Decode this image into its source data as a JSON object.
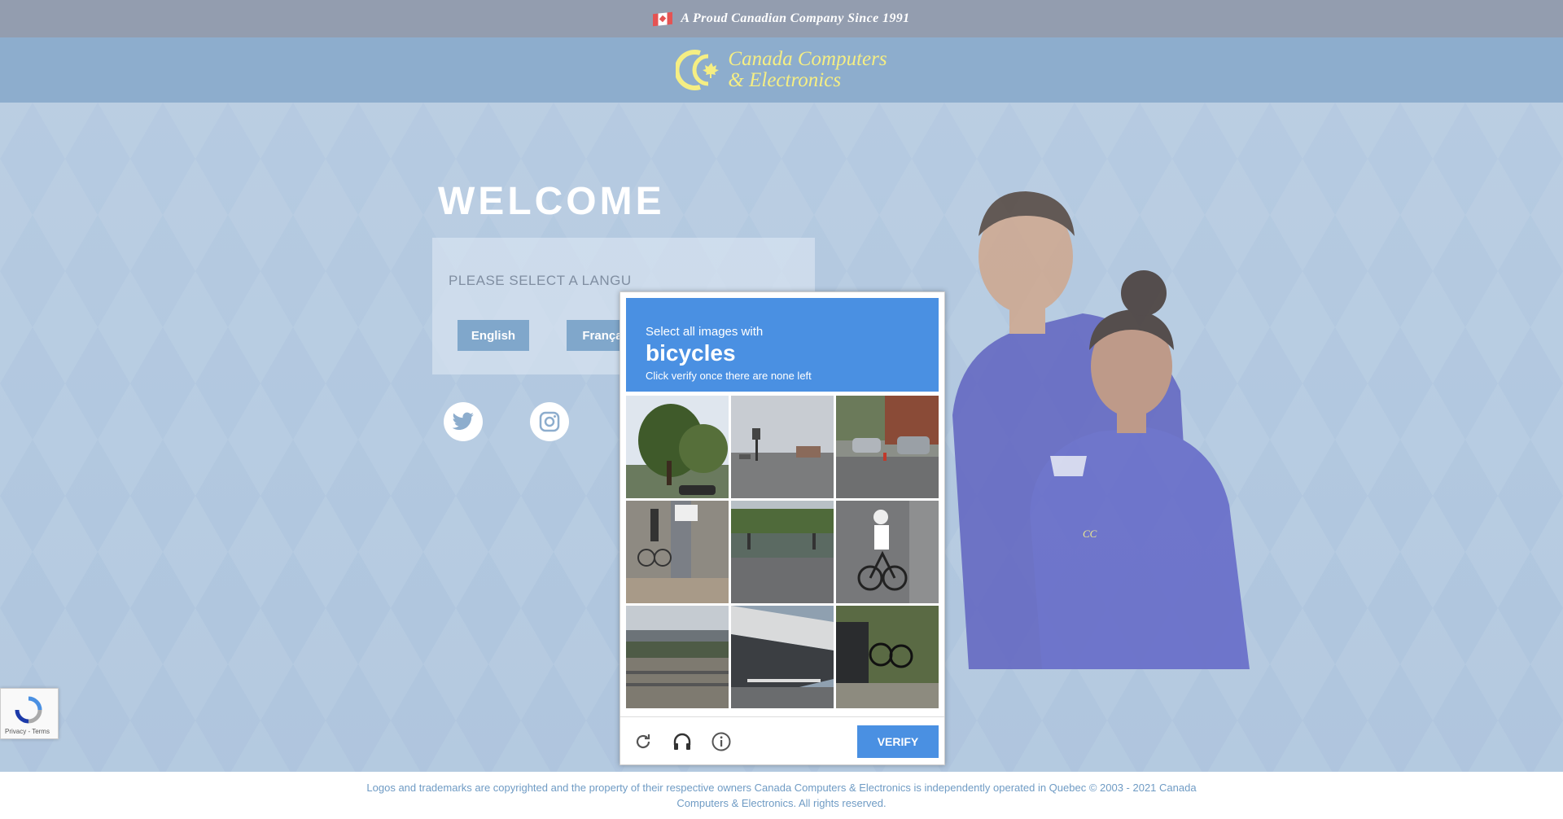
{
  "banner": {
    "tagline": "A Proud Canadian Company Since 1991",
    "flag_icon": "canada-flag-icon"
  },
  "header": {
    "logo_line1": "Canada Computers",
    "logo_line2": "& Electronics",
    "logo_color": "#f4ec72"
  },
  "welcome": {
    "title": "WELCOME",
    "language_prompt": "PLEASE SELECT A LANGU",
    "english_label": "English",
    "french_label": "França"
  },
  "social": [
    "twitter-icon",
    "instagram-icon"
  ],
  "recaptcha_badge": {
    "terms": "Privacy - Terms"
  },
  "captcha": {
    "instruction": "Select all images with",
    "object": "bicycles",
    "hint": "Click verify once there are none left",
    "verify_label": "VERIFY",
    "accent": "#4a90e2",
    "tiles": [
      "trees-with-car",
      "road-intersection",
      "street-with-cars",
      "bike-on-sidewalk",
      "train-station",
      "cyclist-on-road",
      "overpass-highway",
      "bridge-underside",
      "bikes-parked-by-car"
    ]
  },
  "footer": {
    "text": "Logos and trademarks are copyrighted and the property of their respective owners Canada Computers & Electronics is independently operated in Quebec © 2003 - 2021 Canada Computers & Electronics. All rights reserved."
  }
}
